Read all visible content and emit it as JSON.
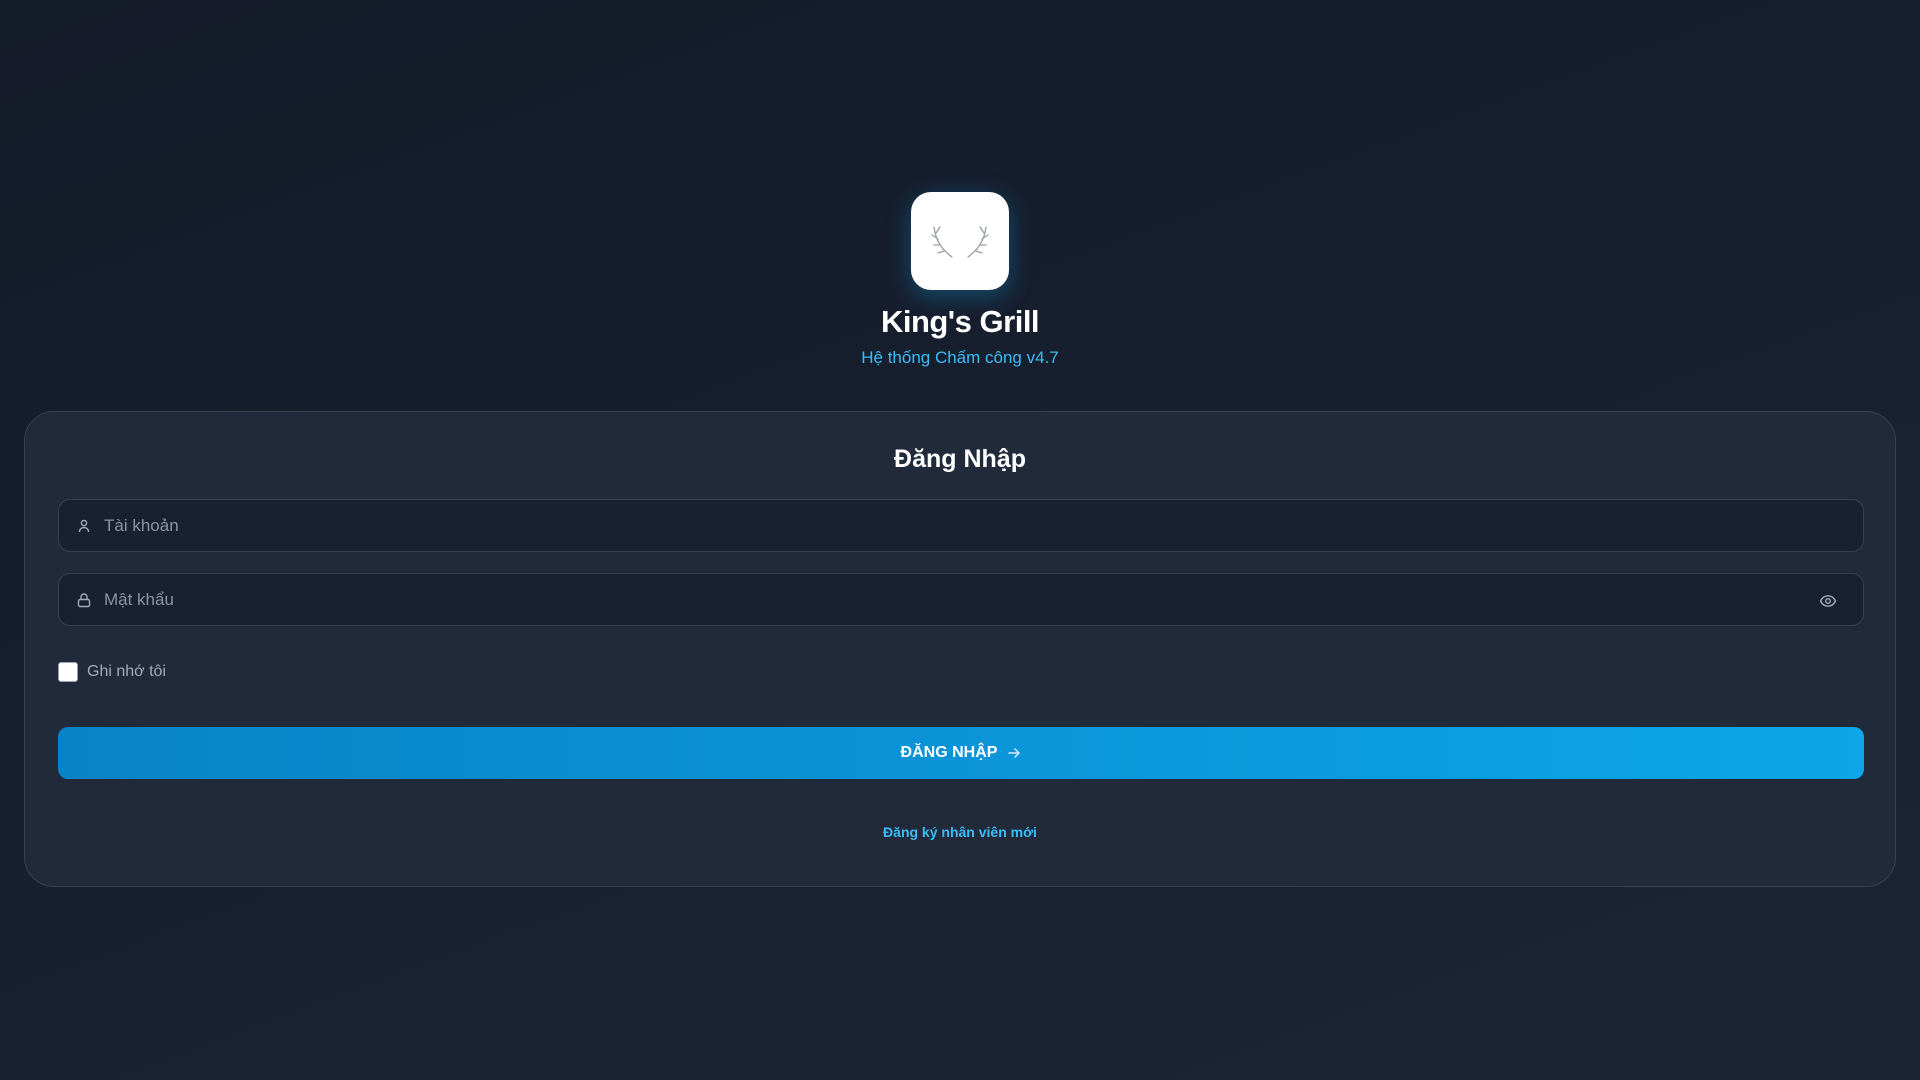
{
  "brand": {
    "name": "King's Grill",
    "subtitle": "Hệ thống Chấm công v4.7",
    "logo_icon": "antlers-icon"
  },
  "login": {
    "heading": "Đăng Nhập",
    "username": {
      "placeholder": "Tài khoản",
      "value": "",
      "icon": "user-icon"
    },
    "password": {
      "placeholder": "Mật khẩu",
      "value": "",
      "icon": "lock-icon",
      "toggle_icon": "eye-icon"
    },
    "remember_label": "Ghi nhớ tôi",
    "remember_checked": false,
    "submit_label": "ĐĂNG NHẬP",
    "register_link": "Đăng ký nhân viên mới"
  },
  "colors": {
    "accent": "#0ea5e9",
    "link": "#38bdf8",
    "card": "#212a3a"
  }
}
